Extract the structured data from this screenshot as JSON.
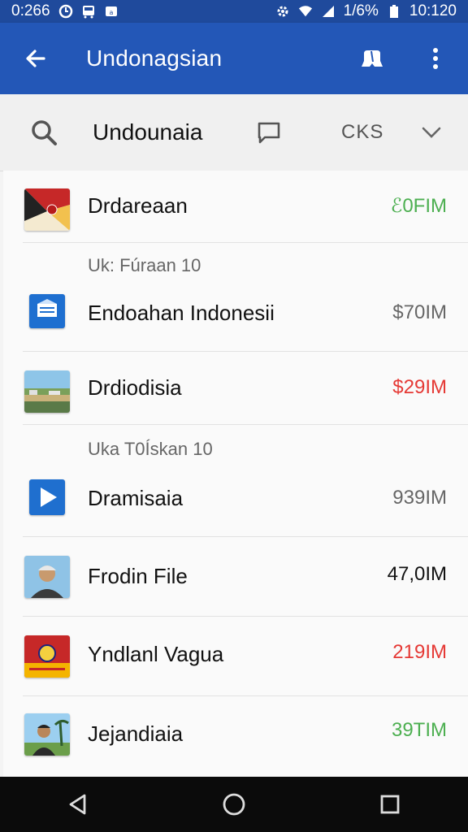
{
  "status_bar": {
    "time_left": "0:266",
    "battery": "1/6%",
    "time_right": "10:120"
  },
  "app_bar": {
    "title": "Undonagsian",
    "back_icon": "arrow-back-icon",
    "action_icon": "pin-icon",
    "more_icon": "more-vert-icon"
  },
  "filter_bar": {
    "query": "Undounaia",
    "sort_label": "CKS"
  },
  "list": {
    "sections": [
      "Uk: Fúraan 10",
      "Uka T0Ískan 10"
    ],
    "items": [
      {
        "name": "Drdareaan",
        "value": "ℰ0FIM",
        "value_color": "#4caf50"
      },
      {
        "name": "Endoahan Indonesii",
        "value": "$70IM",
        "value_color": "#666666"
      },
      {
        "name": "Drdiodisia",
        "value": "$29IM",
        "value_color": "#e53935"
      },
      {
        "name": "Dramisaia",
        "value": "939IM",
        "value_color": "#666666"
      },
      {
        "name": "Frodin File",
        "value": "47,0IM",
        "value_color": "#111111"
      },
      {
        "name": "Yndlanl Vagua",
        "value": "219IM",
        "value_color": "#e53935"
      },
      {
        "name": "Jejandiaia",
        "value": "39TIM",
        "value_color": "#4caf50"
      }
    ]
  },
  "colors": {
    "app_bar": "#2357b7",
    "status_bar": "#1f4a9c",
    "positive": "#4caf50",
    "negative": "#e53935"
  }
}
